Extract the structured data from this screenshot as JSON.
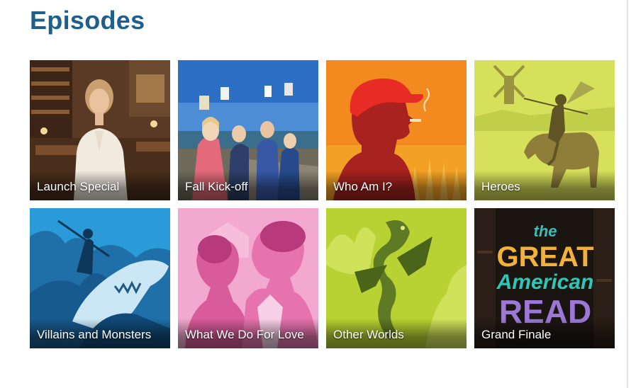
{
  "page": {
    "title": "Episodes"
  },
  "episodes": [
    {
      "label": "Launch Special"
    },
    {
      "label": "Fall Kick-off"
    },
    {
      "label": "Who Am I?"
    },
    {
      "label": "Heroes"
    },
    {
      "label": "Villains and Monsters"
    },
    {
      "label": "What We Do For Love"
    },
    {
      "label": "Other Worlds"
    },
    {
      "label": "Grand Finale"
    }
  ],
  "logo": {
    "the": "the",
    "great": "GREAT",
    "american": "American",
    "read": "READ"
  },
  "colors": {
    "title": "#1f5f8b",
    "who_am_i_bg": "#f28a1f",
    "heroes_bg": "#d6e05a",
    "villains_bg": "#2b9ad8",
    "love_bg": "#f3a8cf",
    "other_worlds_bg": "#b7d232",
    "finale_bg": "#1b1512"
  }
}
